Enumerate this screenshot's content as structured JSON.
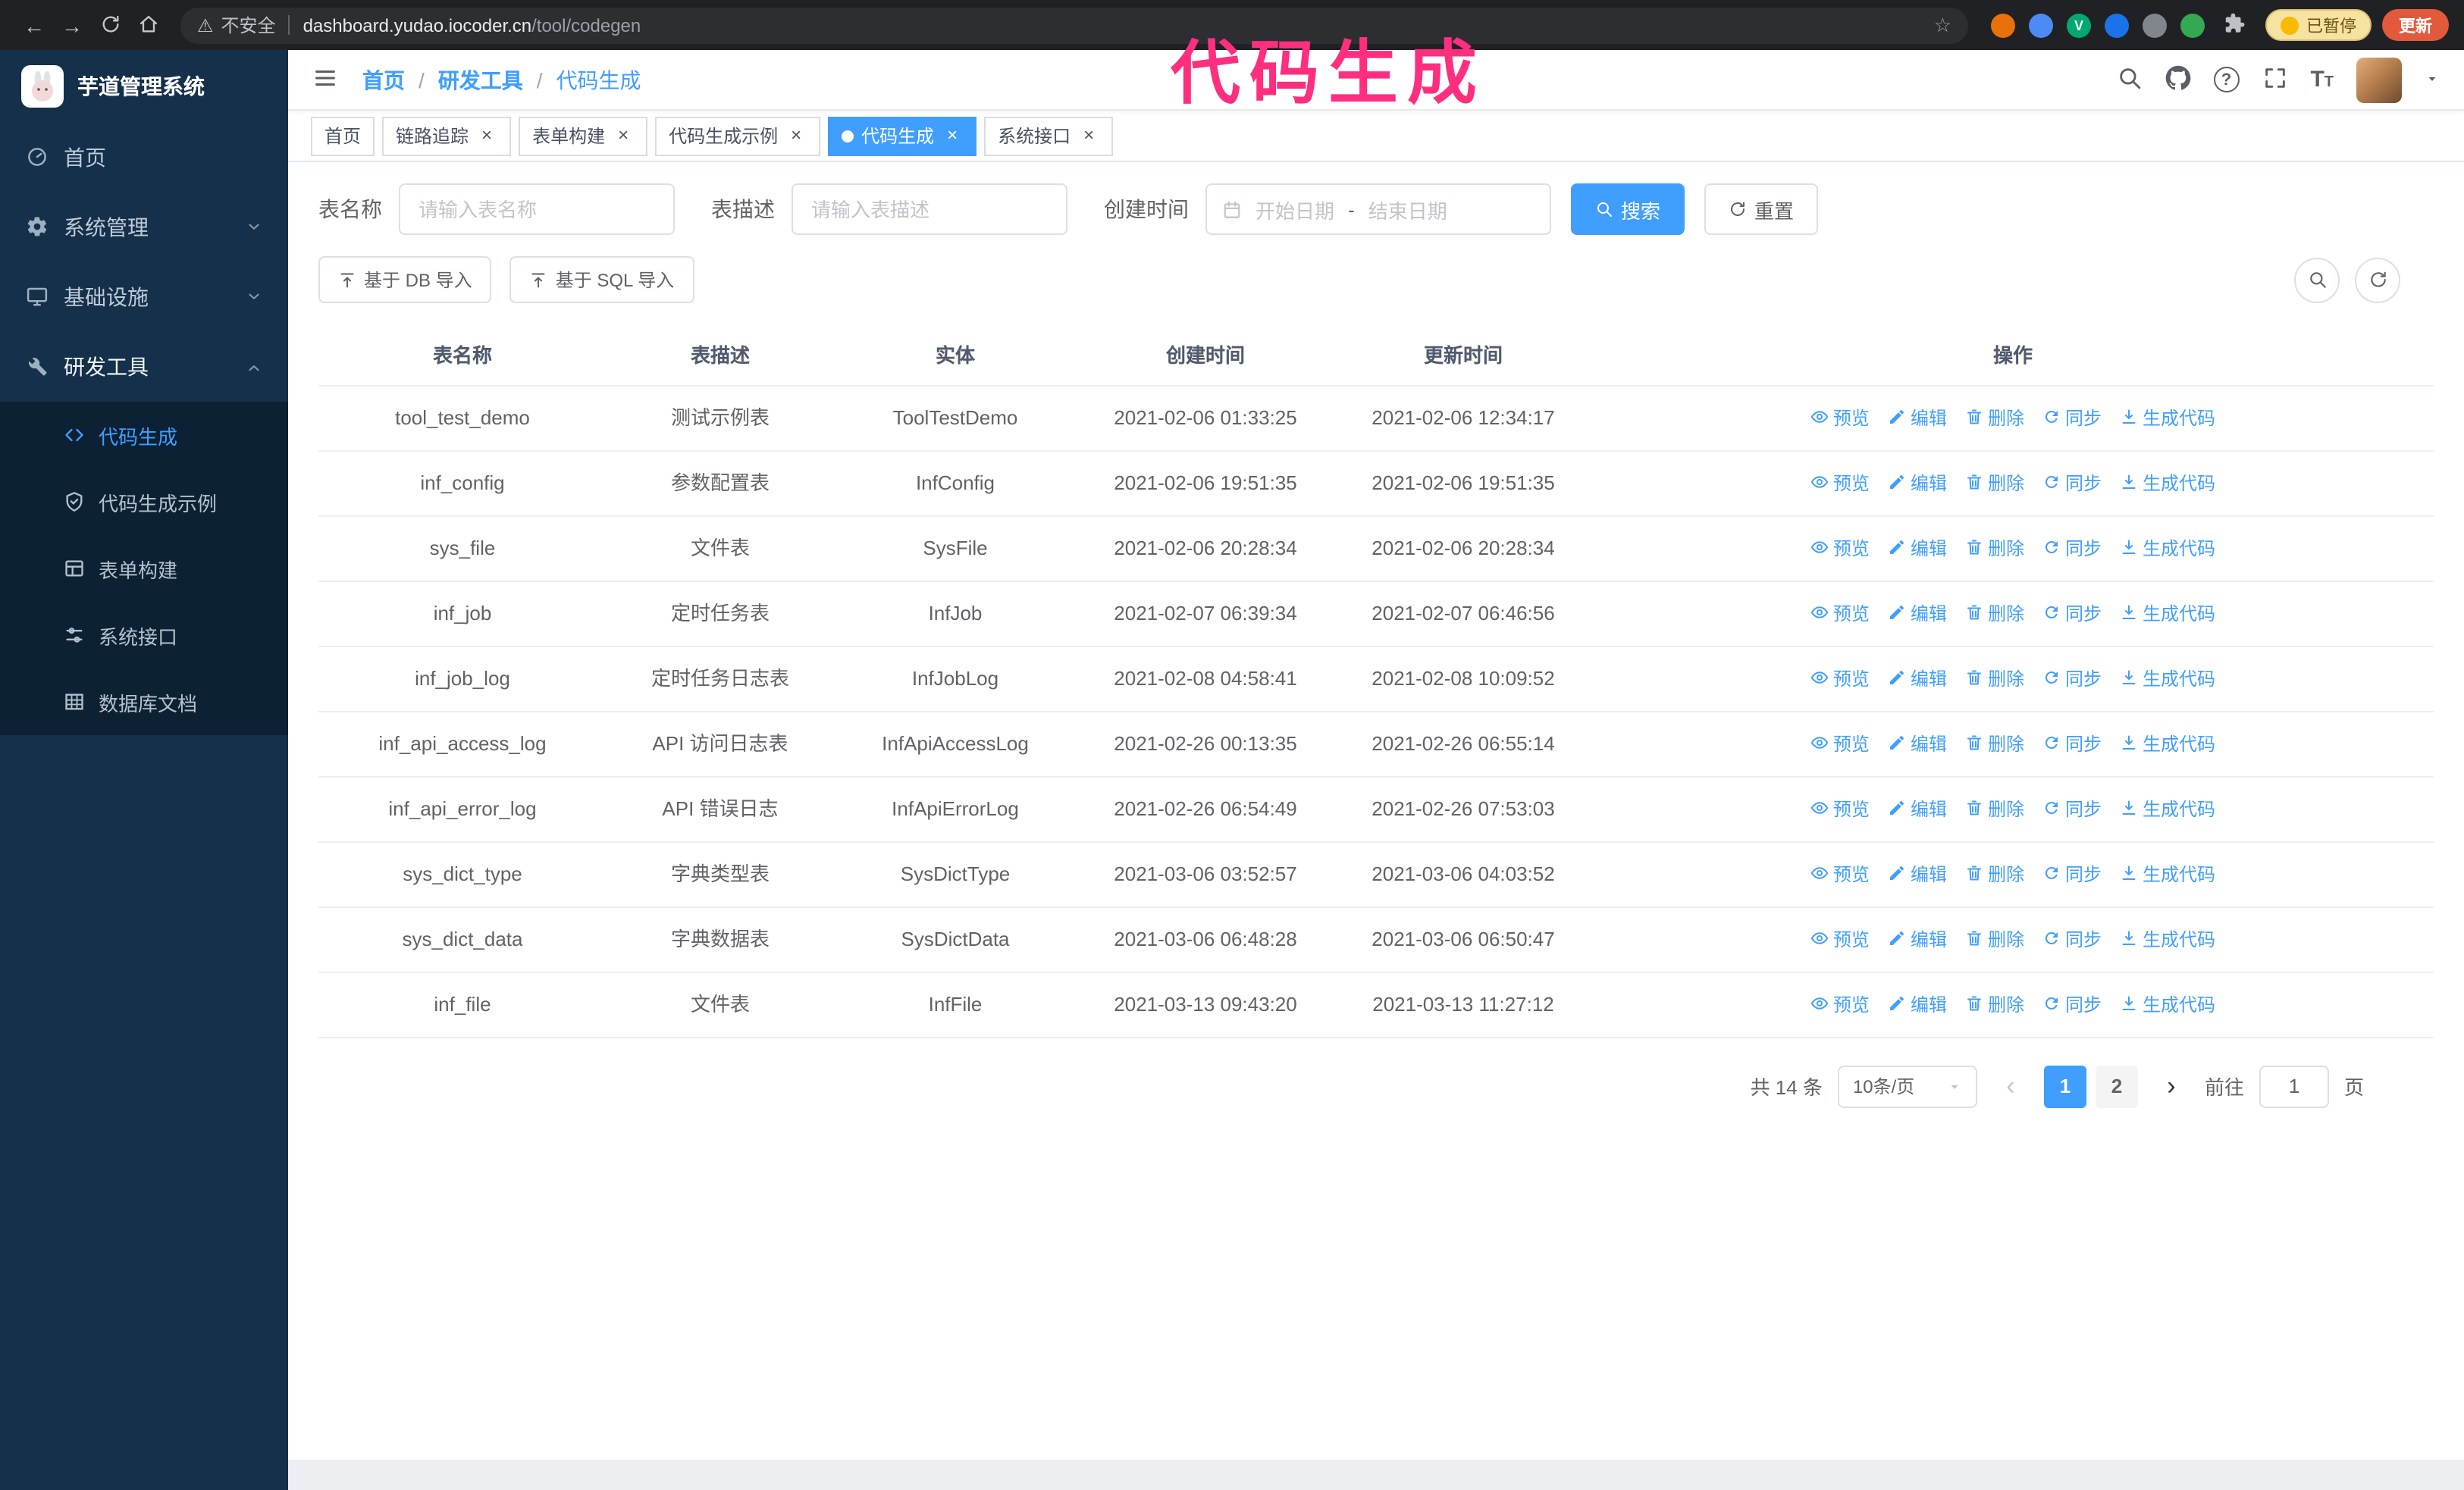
{
  "colors": {
    "primary": "#409eff",
    "sidebar_bg": "#14304a",
    "annotation_pink": "#ff2e7e",
    "update_button": "#e2593c",
    "active_tab": "#409eff"
  },
  "annotation": {
    "text": "代码生成"
  },
  "browser": {
    "security_label": "不安全",
    "url_host": "dashboard.yudao.iocoder.cn",
    "url_path": "/tool/codegen",
    "paused_badge": "已暂停",
    "update_button": "更新",
    "extensions": [
      {
        "name": "extension-orange",
        "color": "#e8710a"
      },
      {
        "name": "extension-blue",
        "color": "#4c8bf5"
      },
      {
        "name": "extension-green-check",
        "color": "#00a971",
        "glyph": "V"
      },
      {
        "name": "extension-people",
        "color": "#1a73e8"
      },
      {
        "name": "extension-dark",
        "color": "#80868b"
      },
      {
        "name": "extension-leaf",
        "color": "#34a853"
      }
    ]
  },
  "sidebar": {
    "logo_title": "芋道管理系统",
    "menu": [
      {
        "id": "home",
        "label": "首页",
        "icon": "dashboard"
      },
      {
        "id": "system",
        "label": "系统管理",
        "icon": "gear",
        "chevron": "down"
      },
      {
        "id": "infra",
        "label": "基础设施",
        "icon": "monitor",
        "chevron": "down"
      },
      {
        "id": "devtools",
        "label": "研发工具",
        "icon": "tools",
        "chevron": "up",
        "expanded": true
      }
    ],
    "submenu": [
      {
        "id": "codegen",
        "label": "代码生成",
        "icon": "code",
        "active": true
      },
      {
        "id": "codegen-example",
        "label": "代码生成示例",
        "icon": "shield"
      },
      {
        "id": "form-builder",
        "label": "表单构建",
        "icon": "form"
      },
      {
        "id": "system-api",
        "label": "系统接口",
        "icon": "api"
      },
      {
        "id": "db-doc",
        "label": "数据库文档",
        "icon": "database"
      }
    ]
  },
  "breadcrumb": [
    "首页",
    "研发工具",
    "代码生成"
  ],
  "tabs": [
    {
      "id": "home",
      "label": "首页",
      "closable": false
    },
    {
      "id": "tracing",
      "label": "链路追踪",
      "closable": true
    },
    {
      "id": "form-builder",
      "label": "表单构建",
      "closable": true
    },
    {
      "id": "codegen-example",
      "label": "代码生成示例",
      "closable": true
    },
    {
      "id": "codegen",
      "label": "代码生成",
      "closable": true,
      "active": true
    },
    {
      "id": "system-api",
      "label": "系统接口",
      "closable": true
    }
  ],
  "filters": {
    "table_name_label": "表名称",
    "table_name_placeholder": "请输入表名称",
    "table_desc_label": "表描述",
    "table_desc_placeholder": "请输入表描述",
    "create_time_label": "创建时间",
    "date_start_placeholder": "开始日期",
    "date_separator": "-",
    "date_end_placeholder": "结束日期",
    "search_button": "搜索",
    "reset_button": "重置"
  },
  "toolbar": {
    "import_db": "基于 DB 导入",
    "import_sql": "基于 SQL 导入"
  },
  "table": {
    "columns": [
      "表名称",
      "表描述",
      "实体",
      "创建时间",
      "更新时间",
      "操作"
    ],
    "actions": [
      {
        "name": "preview",
        "label": "预览",
        "icon": "eye"
      },
      {
        "name": "edit",
        "label": "编辑",
        "icon": "edit"
      },
      {
        "name": "delete",
        "label": "删除",
        "icon": "delete"
      },
      {
        "name": "sync",
        "label": "同步",
        "icon": "sync"
      },
      {
        "name": "generate-code",
        "label": "生成代码",
        "icon": "download"
      }
    ],
    "rows": [
      {
        "name": "tool_test_demo",
        "desc": "测试示例表",
        "entity": "ToolTestDemo",
        "create_time": "2021-02-06 01:33:25",
        "update_time": "2021-02-06 12:34:17"
      },
      {
        "name": "inf_config",
        "desc": "参数配置表",
        "entity": "InfConfig",
        "create_time": "2021-02-06 19:51:35",
        "update_time": "2021-02-06 19:51:35"
      },
      {
        "name": "sys_file",
        "desc": "文件表",
        "entity": "SysFile",
        "create_time": "2021-02-06 20:28:34",
        "update_time": "2021-02-06 20:28:34"
      },
      {
        "name": "inf_job",
        "desc": "定时任务表",
        "entity": "InfJob",
        "create_time": "2021-02-07 06:39:34",
        "update_time": "2021-02-07 06:46:56"
      },
      {
        "name": "inf_job_log",
        "desc": "定时任务日志表",
        "entity": "InfJobLog",
        "create_time": "2021-02-08 04:58:41",
        "update_time": "2021-02-08 10:09:52"
      },
      {
        "name": "inf_api_access_log",
        "desc": "API 访问日志表",
        "entity": "InfApiAccessLog",
        "create_time": "2021-02-26 00:13:35",
        "update_time": "2021-02-26 06:55:14"
      },
      {
        "name": "inf_api_error_log",
        "desc": "API 错误日志",
        "entity": "InfApiErrorLog",
        "create_time": "2021-02-26 06:54:49",
        "update_time": "2021-02-26 07:53:03"
      },
      {
        "name": "sys_dict_type",
        "desc": "字典类型表",
        "entity": "SysDictType",
        "create_time": "2021-03-06 03:52:57",
        "update_time": "2021-03-06 04:03:52"
      },
      {
        "name": "sys_dict_data",
        "desc": "字典数据表",
        "entity": "SysDictData",
        "create_time": "2021-03-06 06:48:28",
        "update_time": "2021-03-06 06:50:47"
      },
      {
        "name": "inf_file",
        "desc": "文件表",
        "entity": "InfFile",
        "create_time": "2021-03-13 09:43:20",
        "update_time": "2021-03-13 11:27:12"
      }
    ]
  },
  "pagination": {
    "total": "共 14 条",
    "page_size": "10条/页",
    "pages": [
      "1",
      "2"
    ],
    "active_page": "1",
    "goto_label": "前往",
    "goto_value": "1",
    "goto_suffix": "页"
  }
}
